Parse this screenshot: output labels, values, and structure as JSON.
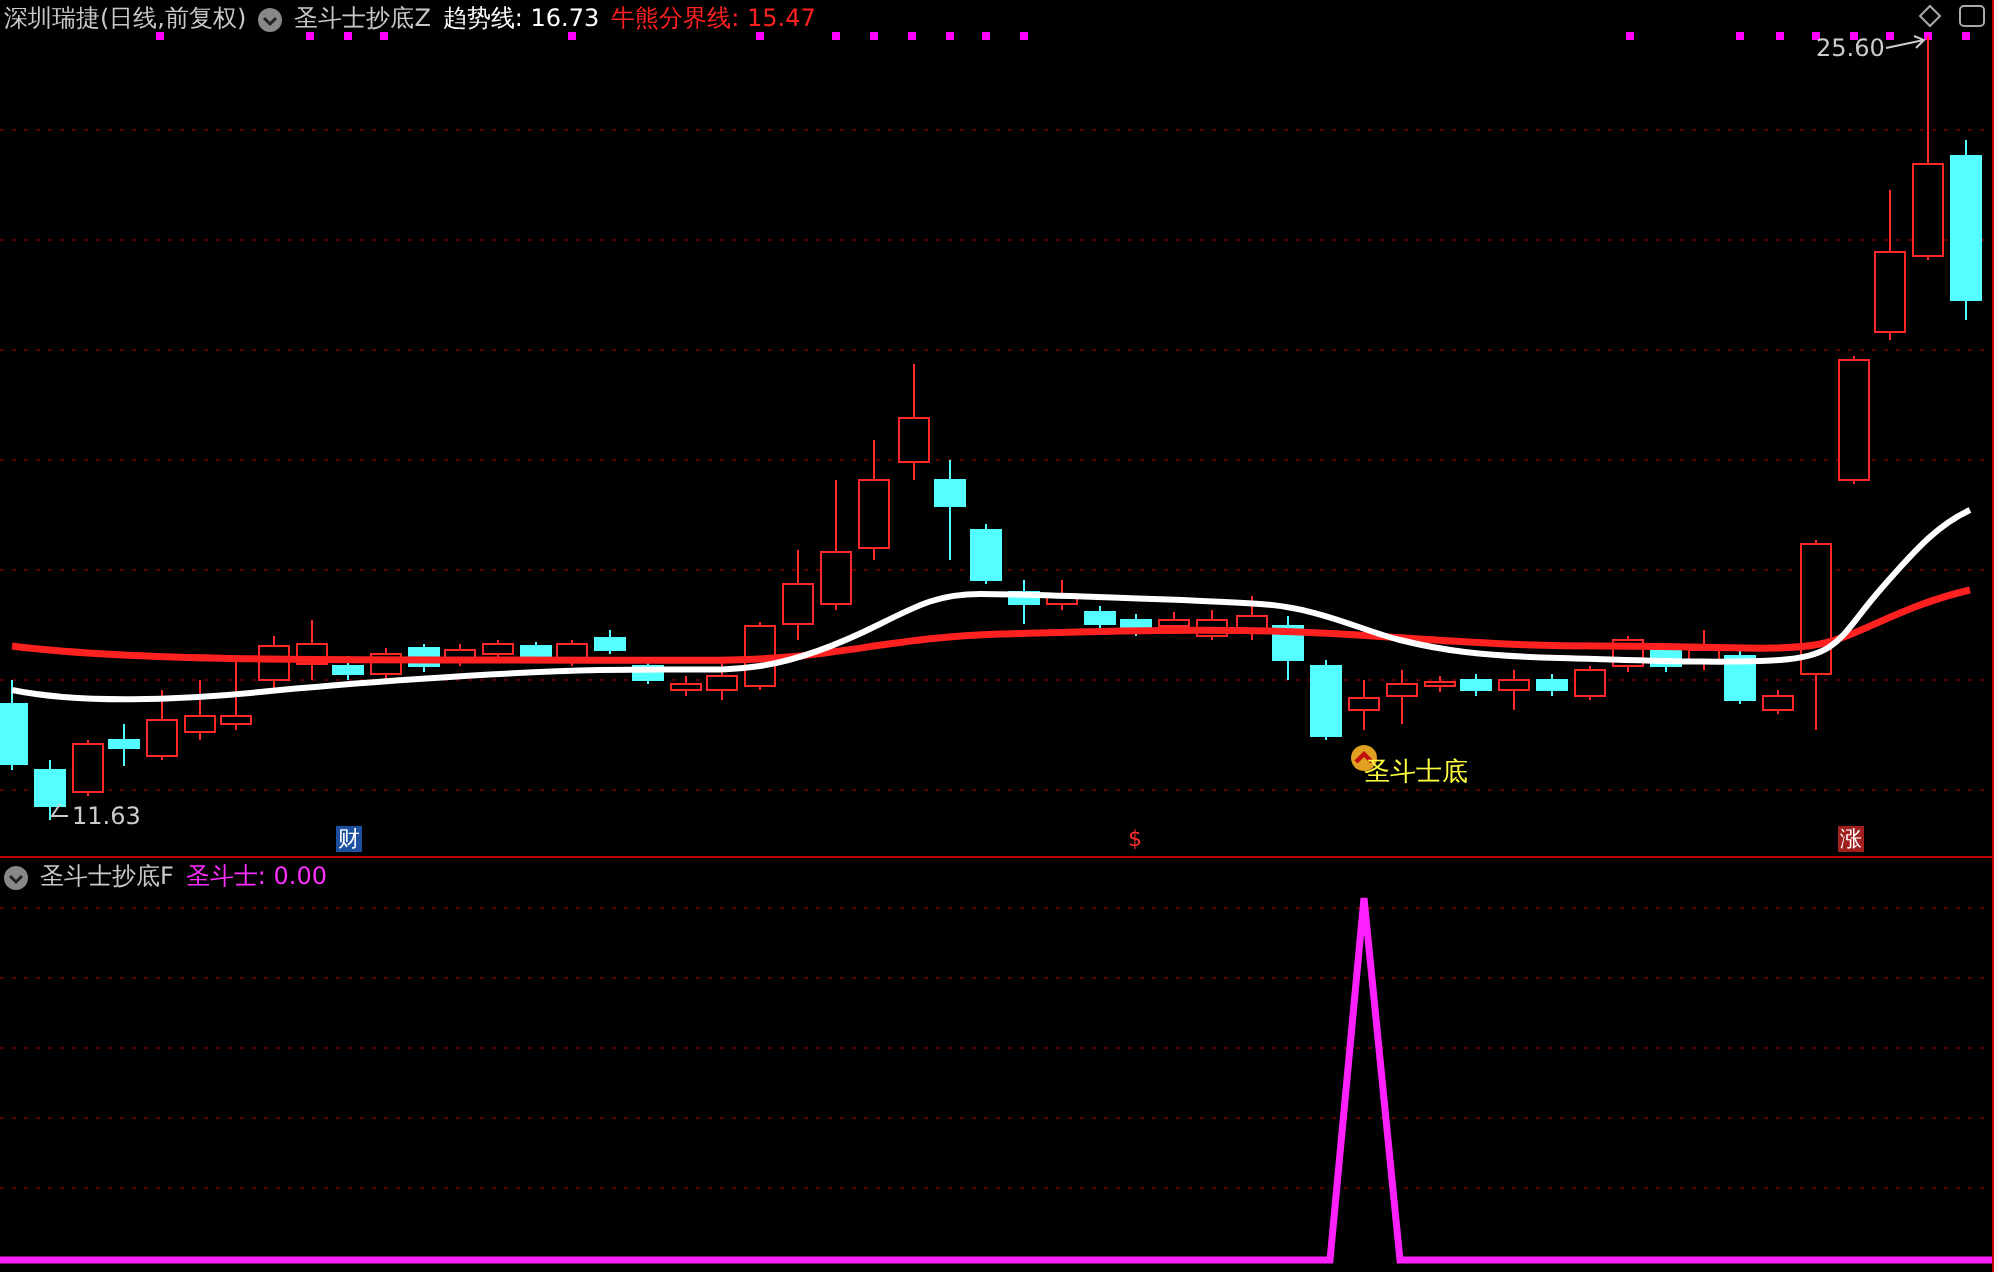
{
  "main_panel": {
    "stock_title": "深圳瑞捷(日线,前复权)",
    "indicator": "圣斗士抄底Z",
    "lines": [
      {
        "label": "趋势线: 16.73",
        "color": "#ffffff"
      },
      {
        "label": "牛熊分界线: 15.47",
        "color": "#ff2020"
      }
    ],
    "high_label": "25.60",
    "low_label": "11.63",
    "signal_label": "圣斗士底",
    "event_markers": [
      {
        "text": "财",
        "kind": "finance"
      },
      {
        "text": "$",
        "kind": "dollar"
      },
      {
        "text": "涨",
        "kind": "rise"
      }
    ]
  },
  "sub_panel": {
    "indicator": "圣斗士抄底F",
    "value_label": "圣斗士: 0.00"
  }
}
